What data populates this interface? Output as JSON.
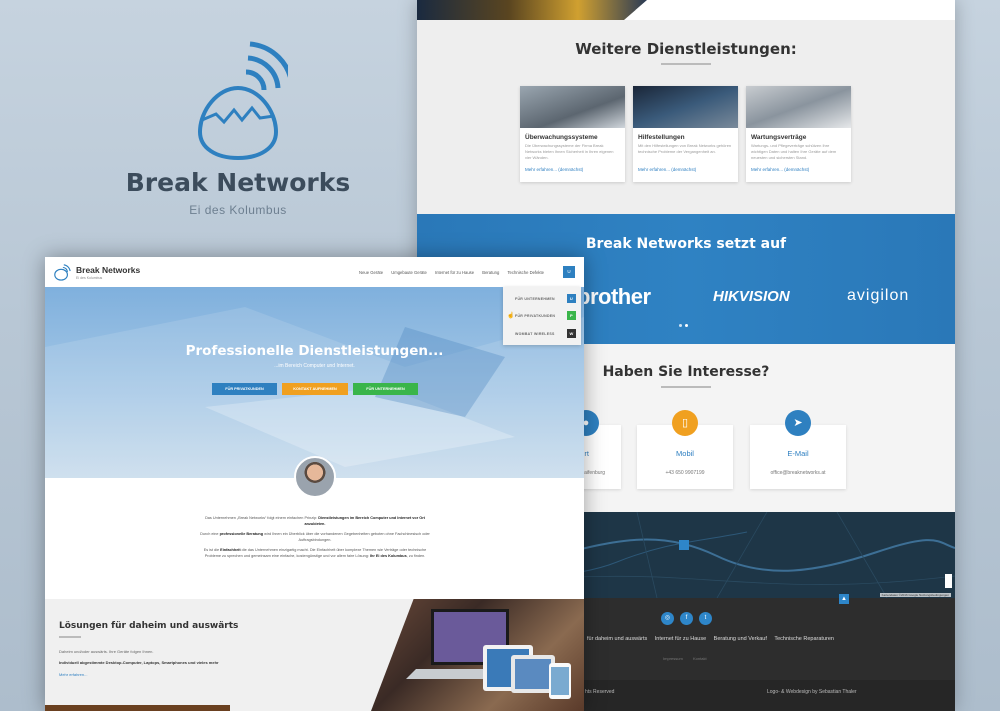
{
  "brand": {
    "name": "Break Networks",
    "tagline": "Ei des Kolumbus"
  },
  "colors": {
    "primary": "#2e80c0",
    "orange": "#f0a020",
    "green": "#3ab54a",
    "dark": "#2d2d2d"
  },
  "right": {
    "services_title": "Weitere Dienstleistungen:",
    "services": [
      {
        "title": "Überwachungssysteme",
        "text": "Die Überwachungssysteme der Firma Break Networks bieten Ihnen Sicherheit in Ihren eigenen vier Wänden.",
        "link": "Mehr erfahren... (demnächst)"
      },
      {
        "title": "Hilfestellungen",
        "text": "Mit den Hilfestellungen von Break Networks gehören technische Probleme der Vergangenheit an.",
        "link": "Mehr erfahren... (demnächst)"
      },
      {
        "title": "Wartungsverträge",
        "text": "Wartungs- und Pflegeverträge schützen Ihre wichtigen Daten und halten Ihre Geräte auf dem neuesten und sichersten Stand.",
        "link": "Mehr erfahren... (demnächst)"
      }
    ],
    "partners_title": "Break Networks setzt auf",
    "partners": [
      "brother",
      "HIKVISION",
      "avigilon"
    ],
    "interest_title": "Haben Sie Interesse?",
    "contacts": [
      {
        "label": "rt",
        "value": "aifenburg",
        "icon": "location-icon"
      },
      {
        "label": "Mobil",
        "value": "+43 650 9907199",
        "icon": "phone-icon"
      },
      {
        "label": "E-Mail",
        "value": "office@breaknetworks.at",
        "icon": "send-icon"
      }
    ],
    "footer_nav": [
      "für daheim und auswärts",
      "Internet für zu Hause",
      "Beratung und Verkauf",
      "Technische Reparaturen"
    ],
    "footer_small": [
      "Impressum",
      "Kontakt"
    ],
    "copyright": "hts Reserved",
    "credit": "Logo- & Webdesign by Sebastian Thaler",
    "map_attribution": "Kartendaten ©2016 Google  Nutzungsbedingungen"
  },
  "left": {
    "nav_links": [
      "Neue Geräte",
      "Umgebaute Geräte",
      "Internet für zu Hause",
      "Beratung",
      "Technische Defekte"
    ],
    "nav_btn": "U",
    "dropdown": [
      {
        "label": "FÜR UNTERNEHMEN",
        "key": "U",
        "color": "#2e80c0"
      },
      {
        "label": "FÜR PRIVATKUNDEN",
        "key": "P",
        "color": "#3ab54a"
      },
      {
        "label": "WOMBAT WIRELESS",
        "key": "W",
        "color": "#333333"
      }
    ],
    "hero_title": "Professionelle Dienstleistungen...",
    "hero_sub": "...im Bereich Computer und Internet.",
    "hero_buttons": [
      "FÜR PRIVATKUNDEN",
      "KONTAKT AUFNEHMEN",
      "FÜR UNTERNEHMEN"
    ],
    "intro": {
      "p1a": "Das Unternehmen „Break Networks“ folgt einem einfachen Prinzip: ",
      "p1b": "Dienstleistungen im Bereich Computer und Internet vor Ort anzubieten.",
      "p2a": "Durch eine ",
      "p2b": "professionelle Beratung",
      "p2c": " wird Ihnen ein Überblick über die vorhandenen Gegebenheiten geboten ohne Fachchinesisch oder Auftragsbindungen.",
      "p3a": "Es ist die ",
      "p3b": "Einfachheit",
      "p3c": " die das Unternehmen einzigartig macht. Die Einfachheit über komplexe Themen wie Verträge oder technische Probleme zu sprechen und gemeinsam eine einfache, kostengünstige und vor allem faire Lösung: ",
      "p3d": "Ihr Ei des Kolumbus",
      "p3e": ", zu finden."
    },
    "solutions_title": "Lösungen für daheim und auswärts",
    "solutions_t1": "Daheim und/oder auswärts. Ihre Geräte folgen Ihnen.",
    "solutions_t2": "Individuell abgestimmte Desktop-Computer, Laptops, Smartphones und vieles mehr",
    "solutions_link": "Mehr erfahren..."
  }
}
